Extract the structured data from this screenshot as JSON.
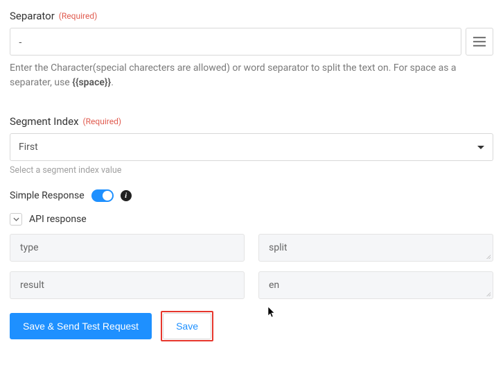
{
  "separator": {
    "label": "Separator",
    "required": "(Required)",
    "value": "-",
    "help_prefix": "Enter the Character(special charecters are allowed) or word separator to split the text on. For space as a separater, use ",
    "help_code": "{{space}}",
    "help_suffix": "."
  },
  "segment_index": {
    "label": "Segment Index",
    "required": "(Required)",
    "value": "First",
    "help": "Select a segment index value"
  },
  "simple_response": {
    "label": "Simple Response",
    "on": true
  },
  "api_response": {
    "title": "API response",
    "rows": [
      {
        "key": "type",
        "value": "split"
      },
      {
        "key": "result",
        "value": "en"
      }
    ]
  },
  "buttons": {
    "primary": "Save & Send Test Request",
    "secondary": "Save"
  }
}
